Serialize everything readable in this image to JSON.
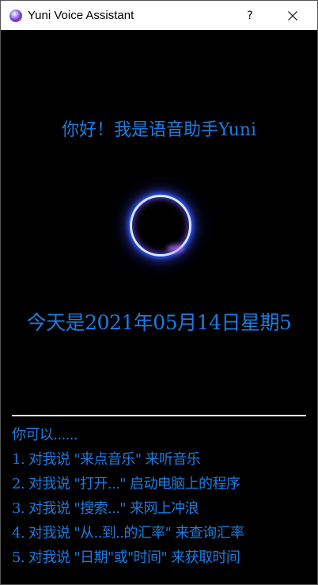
{
  "window": {
    "title": "Yuni Voice Assistant",
    "help_label": "?",
    "app_icon": "siri-orb-icon",
    "close_icon": "close-icon"
  },
  "main": {
    "greeting": "你好！我是语音助手Yuni",
    "date_text": "今天是2021年05月14日星期5",
    "orb_icon": "voice-orb-icon"
  },
  "tips": {
    "heading": "你可以......",
    "items": [
      "1. 对我说 \"来点音乐\" 来听音乐",
      "2. 对我说 \"打开...\" 启动电脑上的程序",
      "3. 对我说 \"搜索...\" 来网上冲浪",
      "4. 对我说 \"从..到..的汇率\" 来查询汇率",
      "5. 对我说 \"日期\"或\"时间\" 来获取时间"
    ]
  },
  "colors": {
    "background": "#000000",
    "accent_text": "#1e7be0",
    "divider": "#e8e8e8"
  }
}
